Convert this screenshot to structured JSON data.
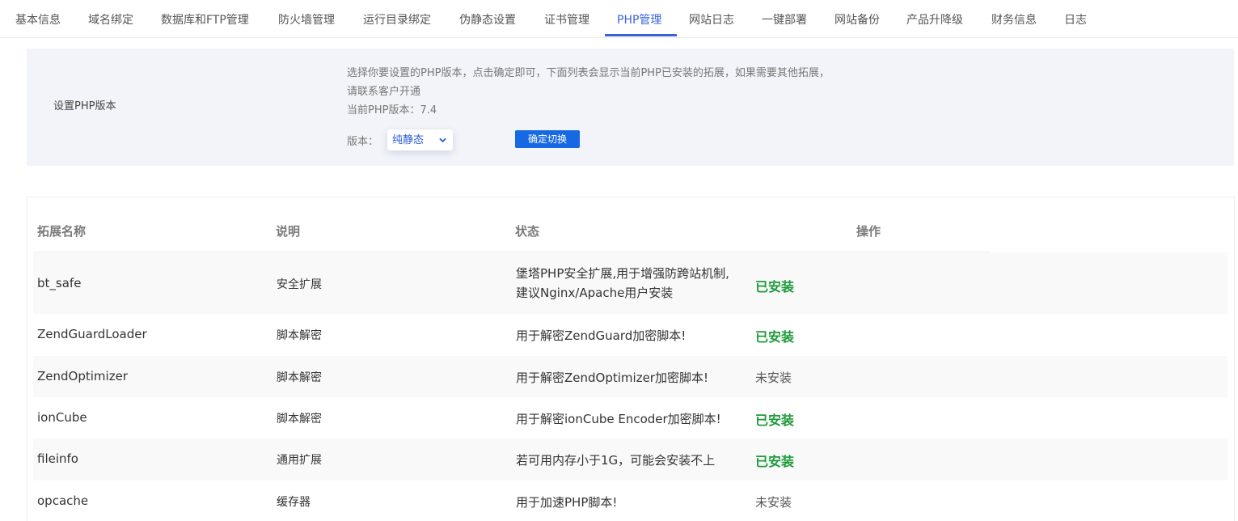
{
  "tabs": [
    {
      "label": "基本信息",
      "active": false
    },
    {
      "label": "域名绑定",
      "active": false
    },
    {
      "label": "数据库和FTP管理",
      "active": false
    },
    {
      "label": "防火墙管理",
      "active": false
    },
    {
      "label": "运行目录绑定",
      "active": false
    },
    {
      "label": "伪静态设置",
      "active": false
    },
    {
      "label": "证书管理",
      "active": false
    },
    {
      "label": "PHP管理",
      "active": true
    },
    {
      "label": "网站日志",
      "active": false
    },
    {
      "label": "一键部署",
      "active": false
    },
    {
      "label": "网站备份",
      "active": false
    },
    {
      "label": "产品升降级",
      "active": false
    },
    {
      "label": "财务信息",
      "active": false
    },
    {
      "label": "日志",
      "active": false
    }
  ],
  "php_settings": {
    "title": "设置PHP版本",
    "desc_line1": "选择你要设置的PHP版本，点击确定即可，下面列表会显示当前PHP已安装的拓展，如果需要其他拓展，",
    "desc_line2": "请联系客户开通",
    "current_version": "当前PHP版本：7.4",
    "version_label": "版本：",
    "version_selected": "纯静态",
    "switch_button": "确定切换"
  },
  "table": {
    "headers": [
      "拓展名称",
      "说明",
      "状态",
      "操作"
    ],
    "rows": [
      {
        "name": "bt_safe",
        "type": "安全扩展",
        "desc_line1": "堡塔PHP安全扩展,用于增强防跨站机制,",
        "desc_line2": "建议Nginx/Apache用户安装",
        "status": "已安装",
        "installed": true
      },
      {
        "name": "ZendGuardLoader",
        "type": "脚本解密",
        "desc_line1": "用于解密ZendGuard加密脚本!",
        "desc_line2": "",
        "status": "已安装",
        "installed": true
      },
      {
        "name": "ZendOptimizer",
        "type": "脚本解密",
        "desc_line1": "用于解密ZendOptimizer加密脚本!",
        "desc_line2": "",
        "status": "未安装",
        "installed": false
      },
      {
        "name": "ionCube",
        "type": "脚本解密",
        "desc_line1": "用于解密ionCube Encoder加密脚本!",
        "desc_line2": "",
        "status": "已安装",
        "installed": true
      },
      {
        "name": "fileinfo",
        "type": "通用扩展",
        "desc_line1": "若可用内存小于1G，可能会安装不上",
        "desc_line2": "",
        "status": "已安装",
        "installed": true
      },
      {
        "name": "opcache",
        "type": "缓存器",
        "desc_line1": "用于加速PHP脚本!",
        "desc_line2": "",
        "status": "未安装",
        "installed": false
      }
    ]
  },
  "colors": {
    "accent": "#3763d8",
    "button": "#1668e3",
    "installed": "#1e9b3a",
    "panel_bg": "#f2f4f9"
  }
}
